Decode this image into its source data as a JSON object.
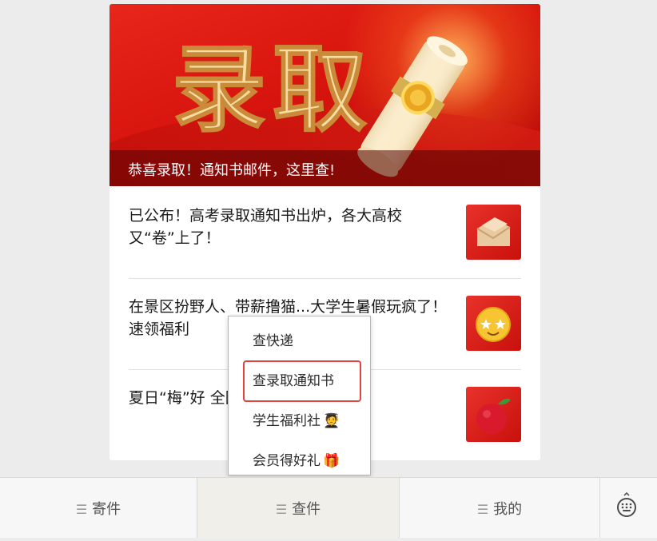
{
  "banner": {
    "art_text": "录取",
    "caption": "恭喜录取！通知书邮件，这里查!"
  },
  "articles": [
    {
      "title": "已公布！高考录取通知书出炉，各大高校又“卷”上了！",
      "thumb_icon": "envelope-icon"
    },
    {
      "title": "在景区扮野人、带薪撸猫...大学生暑假玩疯了！速领福利",
      "thumb_icon": "star-eyes-face-icon"
    },
    {
      "title": "夏日“梅”好 全国，邮政“锁鲜”大揭",
      "thumb_icon": "bayberry-fruit-icon"
    }
  ],
  "popup_menu": {
    "items": [
      {
        "label": "查快递",
        "emoji": ""
      },
      {
        "label": "查录取通知书",
        "emoji": ""
      },
      {
        "label": "学生福利社",
        "emoji": "🧑‍🎓"
      },
      {
        "label": "会员得好礼",
        "emoji": "🎁"
      }
    ],
    "highlighted_index": 1,
    "highlight_color": "#e0443f"
  },
  "tabbar": {
    "tabs": [
      {
        "label": "寄件"
      },
      {
        "label": "查件"
      },
      {
        "label": "我的"
      }
    ],
    "active_index": 1,
    "keyboard_icon": "keyboard-icon"
  },
  "colors": {
    "banner_red": "#d8140e",
    "highlight": "#e0443f"
  }
}
